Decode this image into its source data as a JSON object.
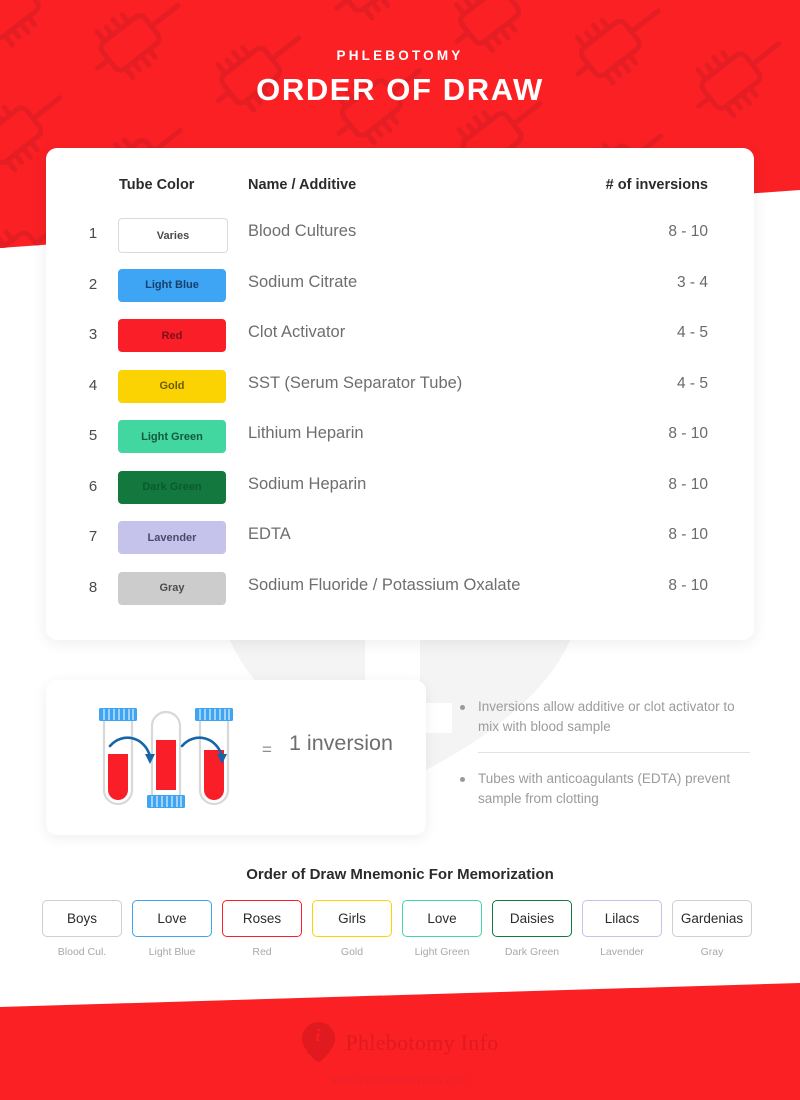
{
  "header": {
    "kicker": "PHLEBOTOMY",
    "title": "ORDER OF DRAW",
    "band_color": "#FA2024",
    "pattern_color": "#E51E24",
    "pattern_icon": "syringe-icon"
  },
  "table": {
    "columns": {
      "index": "",
      "tube_color": "Tube Color",
      "name_additive": "Name / Additive",
      "inversions": "# of inversions"
    },
    "rows": [
      {
        "index": "1",
        "color_label": "Varies",
        "color_hex": "#FFFFFF",
        "text_hex": "#4a4a4a",
        "outlined": true,
        "name": "Blood Cultures",
        "inversions": "8 - 10"
      },
      {
        "index": "2",
        "color_label": "Light Blue",
        "color_hex": "#3DA5F4",
        "text_hex": "#16406b",
        "outlined": false,
        "name": "Sodium Citrate",
        "inversions": "3 - 4"
      },
      {
        "index": "3",
        "color_label": "Red",
        "color_hex": "#FA1E28",
        "text_hex": "#7d1117",
        "outlined": false,
        "name": "Clot Activator",
        "inversions": "4 - 5"
      },
      {
        "index": "4",
        "color_label": "Gold",
        "color_hex": "#FBD303",
        "text_hex": "#6e5c02",
        "outlined": false,
        "name": "SST (Serum Separator Tube)",
        "inversions": "4 - 5"
      },
      {
        "index": "5",
        "color_label": "Light Green",
        "color_hex": "#42D6A0",
        "text_hex": "#15573f",
        "outlined": false,
        "name": "Lithium Heparin",
        "inversions": "8 - 10"
      },
      {
        "index": "6",
        "color_label": "Dark Green",
        "color_hex": "#12783E",
        "text_hex": "#0b5a2d",
        "outlined": false,
        "name": "Sodium Heparin",
        "inversions": "8 - 10"
      },
      {
        "index": "7",
        "color_label": "Lavender",
        "color_hex": "#C5C2EC",
        "text_hex": "#4b4a68",
        "outlined": false,
        "name": "EDTA",
        "inversions": "8 - 10"
      },
      {
        "index": "8",
        "color_label": "Gray",
        "color_hex": "#CCCCCC",
        "text_hex": "#4d4d4d",
        "outlined": false,
        "name": "Sodium Fluoride / Potassium Oxalate",
        "inversions": "8 - 10"
      }
    ]
  },
  "inversion": {
    "equals_sign": "=",
    "label": "1 inversion",
    "diagram_icon": "blood-tube-inversion-icon",
    "tube_cap_color": "#3DA5F4",
    "tube_blood_color": "#FA1E28",
    "arrow_color": "#1565A8"
  },
  "notes": [
    "Inversions allow additive or clot activator to mix with blood sample",
    "Tubes with anticoagulants (EDTA) prevent sample from clotting"
  ],
  "mnemonic": {
    "title": "Order of Draw Mnemonic For Memorization",
    "items": [
      {
        "word": "Boys",
        "sub": "Blood Cul.",
        "border_hex": "#cfcfcf"
      },
      {
        "word": "Love",
        "sub": "Light Blue",
        "border_hex": "#3DA5F4"
      },
      {
        "word": "Roses",
        "sub": "Red",
        "border_hex": "#FA1E28"
      },
      {
        "word": "Girls",
        "sub": "Gold",
        "border_hex": "#FBD303"
      },
      {
        "word": "Love",
        "sub": "Light Green",
        "border_hex": "#42D6A0"
      },
      {
        "word": "Daisies",
        "sub": "Dark Green",
        "border_hex": "#12783E"
      },
      {
        "word": "Lilacs",
        "sub": "Lavender",
        "border_hex": "#C5C2EC"
      },
      {
        "word": "Gardenias",
        "sub": "Gray",
        "border_hex": "#cfcfcf"
      }
    ]
  },
  "footer": {
    "brand": "Phlebotomy Info",
    "url": "www.phlebotomyinfo.com",
    "logo_icon": "info-pin-icon",
    "logo_letter": "i",
    "band_color": "#FA2024",
    "logo_color": "#E01A1F"
  },
  "watermark": {
    "icon": "info-pin-watermark-icon",
    "letter": "i"
  }
}
